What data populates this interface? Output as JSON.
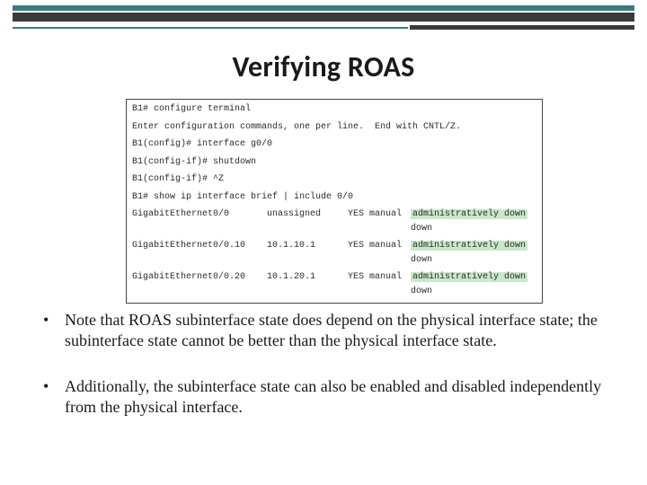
{
  "title": "Verifying ROAS",
  "code": {
    "lines": [
      "B1# configure terminal",
      "Enter configuration commands, one per line.  End with CNTL/Z.",
      "B1(config)# interface g0/0",
      "B1(config-if)# shutdown",
      "B1(config-if)# ^Z",
      "B1# show ip interface brief | include 0/0"
    ],
    "rows": [
      {
        "iface": "GigabitEthernet0/0",
        "ip": "unassigned",
        "ok": "YES manual",
        "status": "administratively down",
        "proto": "down"
      },
      {
        "iface": "GigabitEthernet0/0.10",
        "ip": "10.1.10.1",
        "ok": "YES manual",
        "status": "administratively down",
        "proto": "down"
      },
      {
        "iface": "GigabitEthernet0/0.20",
        "ip": "10.1.20.1",
        "ok": "YES manual",
        "status": "administratively down",
        "proto": "down"
      }
    ]
  },
  "bullets": [
    "Note that ROAS subinterface state does depend on the physical interface state; the subinterface state cannot be better than the physical interface state.",
    "Additionally, the subinterface state can also be enabled and disabled independently from the physical interface."
  ]
}
